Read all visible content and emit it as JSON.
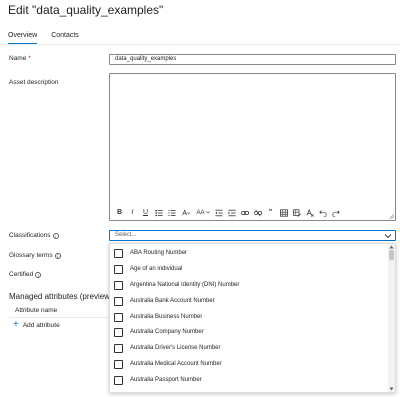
{
  "header": {
    "title": "Edit \"data_quality_examples\""
  },
  "tabs": [
    {
      "label": "Overview"
    },
    {
      "label": "Contacts"
    }
  ],
  "form": {
    "name_label": "Name",
    "required_mark": "*",
    "name_value": "data_quality_examples",
    "description_label": "Asset description",
    "classifications_label": "Classifications",
    "classifications_placeholder": "Select...",
    "glossary_label": "Glossary terms",
    "certified_label": "Certified",
    "info_glyph": "i"
  },
  "toolbar": {
    "bold": "B",
    "italic": "I",
    "underline": "U",
    "font_size": "AA",
    "quote": "\""
  },
  "classification_options": [
    "ABA Routing Number",
    "Age of an individual",
    "Argentina National Identity (DNI) Number",
    "Australia Bank Account Number",
    "Australia Business Number",
    "Australia Company Number",
    "Australia Driver's License Number",
    "Australia Medical Account Number",
    "Australia Passport Number"
  ],
  "managed_attributes": {
    "heading": "Managed attributes (preview)",
    "column_header": "Attribute name",
    "add_label": "Add attribute",
    "add_glyph": "+"
  }
}
